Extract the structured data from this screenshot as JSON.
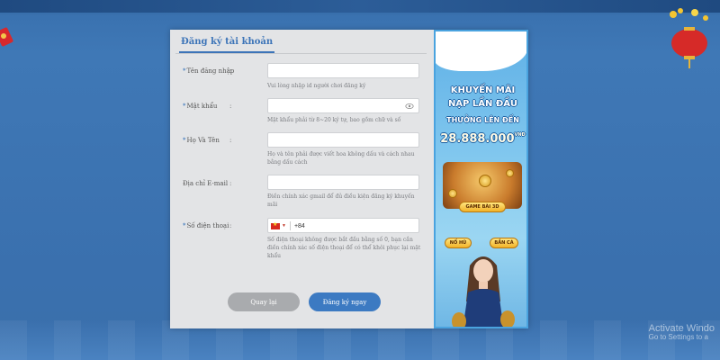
{
  "dialog": {
    "tab_title": "Đăng ký tài khoản",
    "fields": [
      {
        "label": "Tên đăng nhập",
        "colon": ":",
        "hint": "Vui lòng nhập id người chơi đăng ký",
        "value": "",
        "required": true
      },
      {
        "label": "Mật khẩu",
        "colon": ":",
        "hint": "Mật khẩu phải từ 8~20 ký tự, bao gồm chữ và số",
        "value": "",
        "required": true,
        "icon": "eye-icon"
      },
      {
        "label": "Họ Và Tên",
        "colon": ":",
        "hint": "Họ và tên phải được viết hoa không dấu và cách nhau bằng dấu cách",
        "value": "",
        "required": true
      },
      {
        "label": "Địa chỉ E-mail",
        "colon": ":",
        "hint": "Điền chính xác gmail để đủ điều kiện đăng ký khuyến mãi",
        "value": "",
        "required": false
      },
      {
        "label": "Số điện thoại",
        "colon": ":",
        "hint": "Số điện thoại không được bắt đầu bằng số 0, bạn cần điền chính xác số điện thoại để có thể khôi phục lại mật khẩu",
        "value": "",
        "required": true,
        "prefix": "+84",
        "flag": "vietnam-flag-icon"
      }
    ],
    "buttons": {
      "back": "Quay lại",
      "submit": "Đăng ký ngay"
    }
  },
  "promo": {
    "line1": "KHUYẾN MÃI",
    "line2": "NẠP LẦN ĐẦU",
    "line3": "THƯỞNG LÊN ĐẾN",
    "amount": "28.888.000",
    "unit": "VNĐ",
    "badges": [
      "GAME BÀI 3D",
      "NỔ HŨ",
      "BẮN CÁ"
    ]
  },
  "watermark": {
    "line1": "Activate Windo",
    "line2": "Go to Settings to a"
  },
  "colors": {
    "accent": "#3c74b8",
    "submit": "#3c7ac2",
    "back": "#a9abae",
    "background": "#3a70ae"
  }
}
